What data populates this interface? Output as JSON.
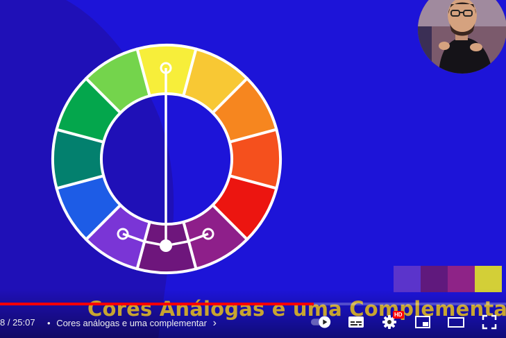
{
  "video": {
    "caption": "Cores Análogas e uma Complementar",
    "background_color": "#1d14d8",
    "wheel_colors": [
      "#f7ee3a",
      "#f8c834",
      "#f6861f",
      "#f5501d",
      "#ec1510",
      "#8e1f8a",
      "#6e167c",
      "#7a35d6",
      "#1d5ce6",
      "#03806e",
      "#04a64c",
      "#74d44c"
    ],
    "swatch_colors": [
      "#5b34cb",
      "#60197d",
      "#8e2387",
      "#d3cf37"
    ]
  },
  "player": {
    "progress_fraction": 0.62,
    "time_display": "8 / 25:07",
    "chapter_separator": "•",
    "chapter_title": "Cores análogas e uma complementar",
    "chapter_chevron": "›",
    "hd_badge": "HD",
    "icons": [
      "chevron-right-icon",
      "autoplay-toggle-icon",
      "subtitles-icon",
      "settings-gear-icon",
      "miniplayer-icon",
      "theater-mode-icon",
      "fullscreen-icon"
    ]
  }
}
